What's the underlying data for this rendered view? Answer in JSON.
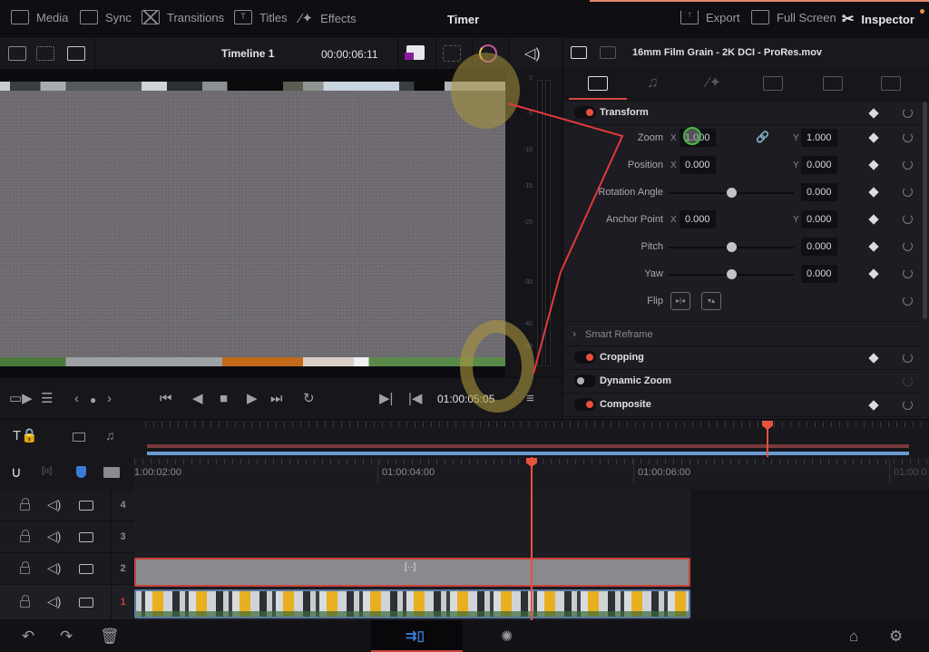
{
  "topbar": {
    "items": [
      {
        "label": "Media",
        "icon": "media-icon"
      },
      {
        "label": "Sync",
        "icon": "sync-icon"
      },
      {
        "label": "Transitions",
        "icon": "transitions-icon"
      },
      {
        "label": "Titles",
        "icon": "titles-icon"
      },
      {
        "label": "Effects",
        "icon": "effects-wand-icon"
      }
    ],
    "title": "Timer",
    "right_items": [
      {
        "label": "Export",
        "icon": "export-icon"
      },
      {
        "label": "Full Screen",
        "icon": "fullscreen-icon"
      },
      {
        "label": "Inspector",
        "icon": "inspector-tools-icon"
      }
    ]
  },
  "viewer": {
    "timeline_name": "Timeline 1",
    "duration": "00:00:06:11",
    "timecode": "01:00:05:05",
    "meter_scale": [
      "0",
      "-5",
      "-10",
      "-15",
      "-20",
      "-30",
      "-40",
      "-50"
    ]
  },
  "inspector": {
    "clip_name": "16mm Film Grain - 2K DCI - ProRes.mov",
    "tabs": [
      "video",
      "audio",
      "effects",
      "transition",
      "image",
      "file"
    ],
    "active_tab": "video",
    "transform": {
      "title": "Transform",
      "enabled": true,
      "params": {
        "zoom": {
          "label": "Zoom",
          "x": "1.000",
          "y": "1.000",
          "linked": true
        },
        "position": {
          "label": "Position",
          "x": "0.000",
          "y": "0.000"
        },
        "rotation": {
          "label": "Rotation Angle",
          "value": "0.000",
          "slider": 0.5
        },
        "anchor": {
          "label": "Anchor Point",
          "x": "0.000",
          "y": "0.000"
        },
        "pitch": {
          "label": "Pitch",
          "value": "0.000",
          "slider": 0.5
        },
        "yaw": {
          "label": "Yaw",
          "value": "0.000",
          "slider": 0.5
        },
        "flip": {
          "label": "Flip"
        }
      },
      "axis_x": "X",
      "axis_y": "Y"
    },
    "sections": [
      {
        "title": "Smart Reframe",
        "collapsible": true
      },
      {
        "title": "Cropping",
        "enabled": true
      },
      {
        "title": "Dynamic Zoom",
        "enabled": false
      },
      {
        "title": "Composite",
        "enabled": true
      }
    ]
  },
  "timeline": {
    "ruler_labels": [
      "1:00:02:00",
      "01:00:04:00",
      "01:00:06:00",
      "01:00:0"
    ],
    "tracks": [
      {
        "number": "4"
      },
      {
        "number": "3"
      },
      {
        "number": "2"
      },
      {
        "number": "1",
        "active": true
      }
    ]
  },
  "colors": {
    "accent_red": "#e8513e",
    "playhead": "#e8513e",
    "mini_blue": "#6a9ad0"
  }
}
